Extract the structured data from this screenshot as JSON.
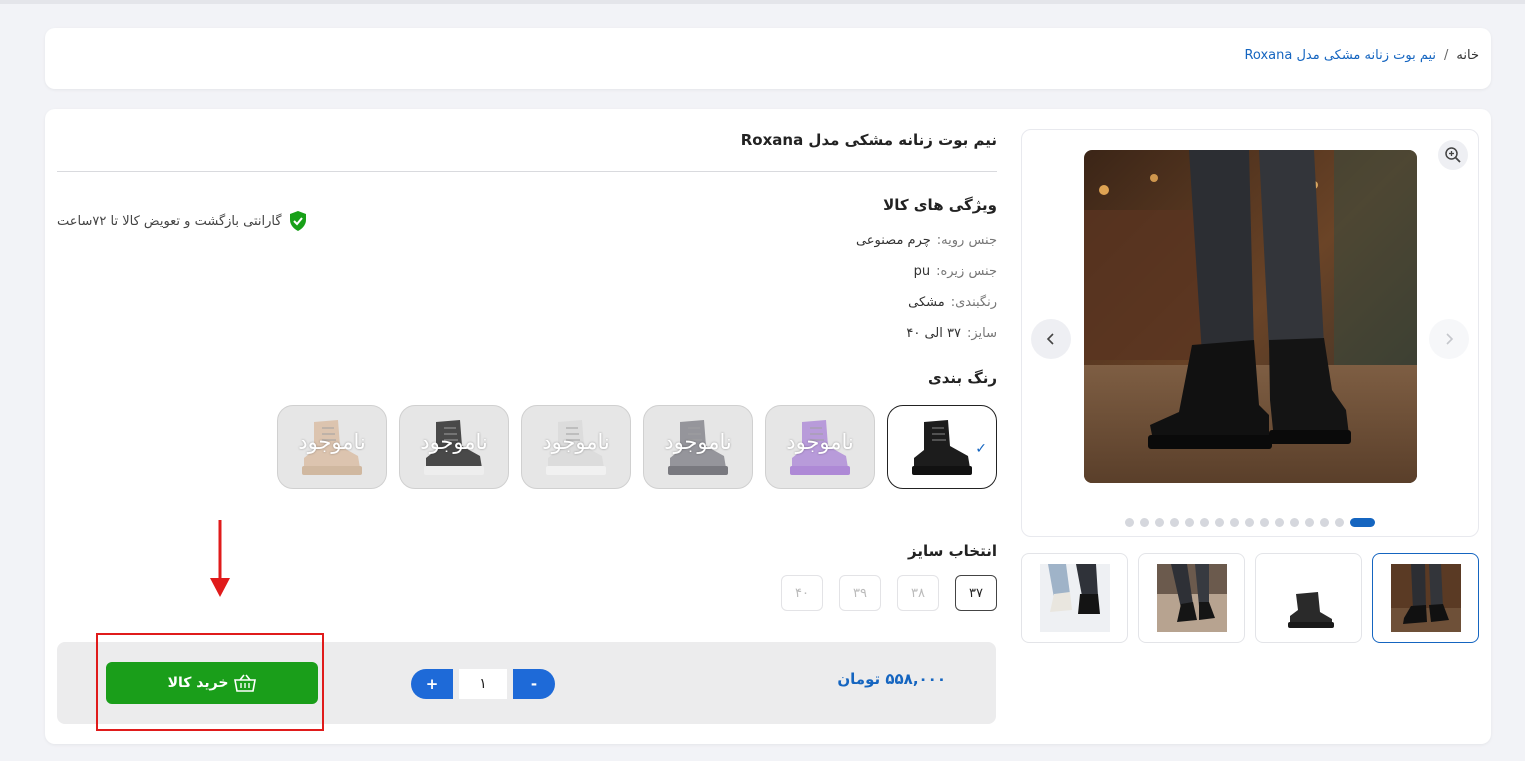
{
  "breadcrumb": {
    "home": "خانه",
    "separator": "/",
    "current": "نیم بوت زنانه مشکی مدل Roxana"
  },
  "product": {
    "title": "نیم بوت زنانه مشکی مدل Roxana",
    "features_heading": "ویژگی های کالا",
    "features": [
      {
        "key": "جنس رویه:",
        "value": "چرم مصنوعی"
      },
      {
        "key": "جنس زیره:",
        "value": "pu"
      },
      {
        "key": "رنگبندی:",
        "value": "مشکی"
      },
      {
        "key": "سایز:",
        "value": "۳۷ الی ۴۰"
      }
    ],
    "warranty": "گارانتی بازگشت و تعویض کالا تا ۷۲ساعت",
    "color_heading": "رنگ بندی",
    "colors": [
      {
        "boot_color": "#1c1c1c",
        "sole": "#111111",
        "available": true
      },
      {
        "boot_color": "#a982d6",
        "sole": "#9b6ad0",
        "available": false,
        "label": "ناموجود"
      },
      {
        "boot_color": "#7a7a82",
        "sole": "#55555c",
        "available": false,
        "label": "ناموجود"
      },
      {
        "boot_color": "#d9d9d9",
        "sole": "#f4f4f4",
        "available": false,
        "label": "ناموجود"
      },
      {
        "boot_color": "#141414",
        "sole": "#f0f0f0",
        "available": false,
        "label": "ناموجود"
      },
      {
        "boot_color": "#d8b89c",
        "sole": "#c9a888",
        "available": false,
        "label": "ناموجود"
      }
    ],
    "selected_check": "✓",
    "size_heading": "انتخاب سایز",
    "sizes": [
      {
        "label": "۳۷",
        "active": true
      },
      {
        "label": "۳۸",
        "active": false
      },
      {
        "label": "۳۹",
        "active": false
      },
      {
        "label": "۴۰",
        "active": false
      }
    ],
    "price": "۵۵۸,۰۰۰ تومان",
    "quantity": "۱",
    "plus": "+",
    "minus": "-",
    "buy_label": "خرید کالا"
  },
  "gallery": {
    "dot_count": 16,
    "active_dot": 1
  },
  "colors": {
    "accent": "#1565c0",
    "buy": "#1a9e1a",
    "annotation": "#e01b1b"
  }
}
